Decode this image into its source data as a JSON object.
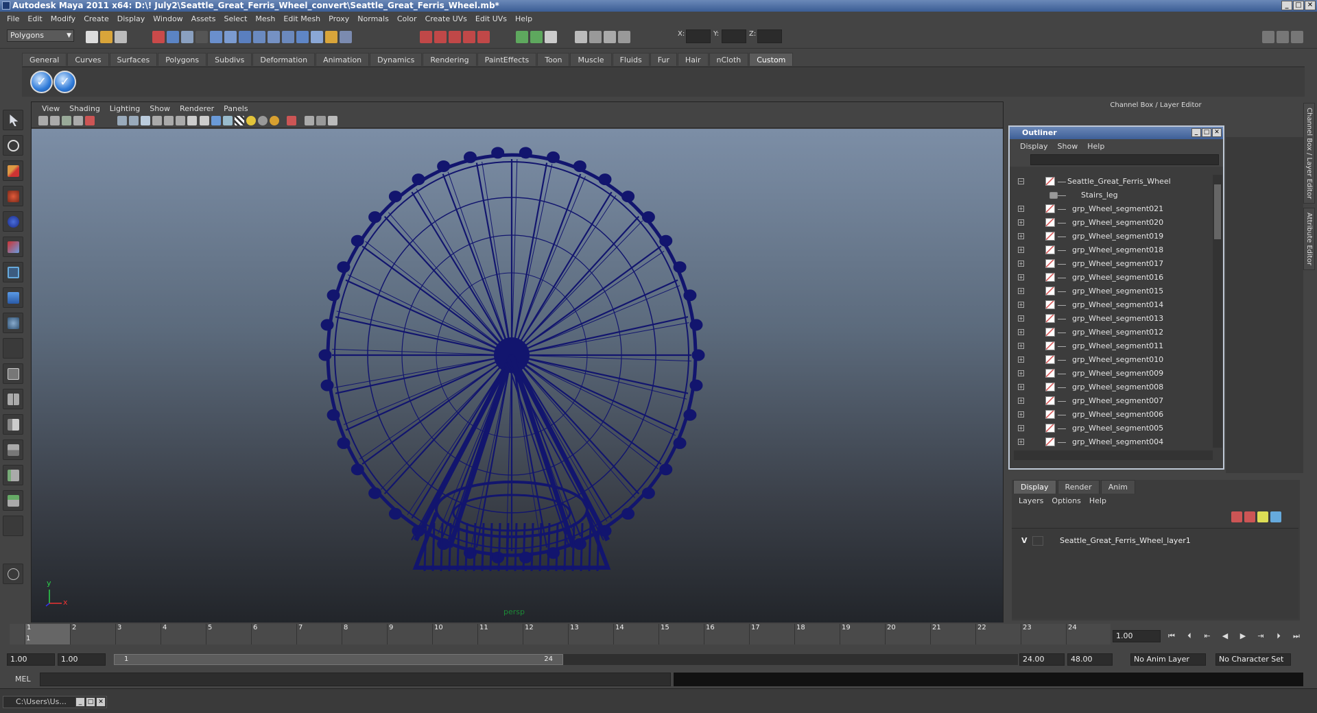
{
  "window": {
    "title": "Autodesk Maya 2011 x64: D:\\! July2\\Seattle_Great_Ferris_Wheel_convert\\Seattle_Great_Ferris_Wheel.mb*",
    "controls": [
      "_",
      "□",
      "✕"
    ]
  },
  "menubar": [
    "File",
    "Edit",
    "Modify",
    "Create",
    "Display",
    "Window",
    "Assets",
    "Select",
    "Mesh",
    "Edit Mesh",
    "Proxy",
    "Normals",
    "Color",
    "Create UVs",
    "Edit UVs",
    "Help"
  ],
  "statusline": {
    "mode": "Polygons",
    "x_label": "X:",
    "y_label": "Y:",
    "z_label": "Z:"
  },
  "shelf": {
    "tabs": [
      "General",
      "Curves",
      "Surfaces",
      "Polygons",
      "Subdivs",
      "Deformation",
      "Animation",
      "Dynamics",
      "Rendering",
      "PaintEffects",
      "Toon",
      "Muscle",
      "Fluids",
      "Fur",
      "Hair",
      "nCloth",
      "Custom"
    ],
    "active_tab": "Custom",
    "buttons": [
      "check-icon",
      "check-icon"
    ]
  },
  "viewport": {
    "menu": [
      "View",
      "Shading",
      "Lighting",
      "Show",
      "Renderer",
      "Panels"
    ],
    "camera_label": "persp",
    "axis_y": "y",
    "axis_x": "x",
    "wire_color": "#12156e"
  },
  "channelbox": {
    "title": "Channel Box / Layer Editor"
  },
  "outliner": {
    "title": "Outliner",
    "menu": [
      "Display",
      "Show",
      "Help"
    ],
    "items": [
      {
        "label": "Seattle_Great_Ferris_Wheel",
        "kind": "root",
        "expander": "−"
      },
      {
        "label": "Stairs_leg",
        "kind": "child",
        "expander": ""
      },
      {
        "label": "grp_Wheel_segment021",
        "kind": "group",
        "expander": "+"
      },
      {
        "label": "grp_Wheel_segment020",
        "kind": "group",
        "expander": "+"
      },
      {
        "label": "grp_Wheel_segment019",
        "kind": "group",
        "expander": "+"
      },
      {
        "label": "grp_Wheel_segment018",
        "kind": "group",
        "expander": "+"
      },
      {
        "label": "grp_Wheel_segment017",
        "kind": "group",
        "expander": "+"
      },
      {
        "label": "grp_Wheel_segment016",
        "kind": "group",
        "expander": "+"
      },
      {
        "label": "grp_Wheel_segment015",
        "kind": "group",
        "expander": "+"
      },
      {
        "label": "grp_Wheel_segment014",
        "kind": "group",
        "expander": "+"
      },
      {
        "label": "grp_Wheel_segment013",
        "kind": "group",
        "expander": "+"
      },
      {
        "label": "grp_Wheel_segment012",
        "kind": "group",
        "expander": "+"
      },
      {
        "label": "grp_Wheel_segment011",
        "kind": "group",
        "expander": "+"
      },
      {
        "label": "grp_Wheel_segment010",
        "kind": "group",
        "expander": "+"
      },
      {
        "label": "grp_Wheel_segment009",
        "kind": "group",
        "expander": "+"
      },
      {
        "label": "grp_Wheel_segment008",
        "kind": "group",
        "expander": "+"
      },
      {
        "label": "grp_Wheel_segment007",
        "kind": "group",
        "expander": "+"
      },
      {
        "label": "grp_Wheel_segment006",
        "kind": "group",
        "expander": "+"
      },
      {
        "label": "grp_Wheel_segment005",
        "kind": "group",
        "expander": "+"
      },
      {
        "label": "grp_Wheel_segment004",
        "kind": "group",
        "expander": "+"
      }
    ]
  },
  "layer_editor": {
    "tabs": [
      "Display",
      "Render",
      "Anim"
    ],
    "active_tab": "Display",
    "menu": [
      "Layers",
      "Options",
      "Help"
    ],
    "layers": [
      {
        "visible": "V",
        "name": "Seattle_Great_Ferris_Wheel_layer1"
      }
    ]
  },
  "side_tabs": [
    "Channel Box / Layer Editor",
    "Attribute Editor"
  ],
  "timeslider": {
    "ticks": [
      "1",
      "2",
      "3",
      "4",
      "5",
      "6",
      "7",
      "8",
      "9",
      "10",
      "11",
      "12",
      "13",
      "14",
      "15",
      "16",
      "17",
      "18",
      "19",
      "20",
      "21",
      "22",
      "23",
      "24"
    ],
    "current_frame": "1",
    "current_time": "1.00"
  },
  "rangeslider": {
    "start_time": "1.00",
    "playback_start": "1.00",
    "range_start": "1",
    "range_end": "24",
    "playback_end": "24.00",
    "end_time": "48.00",
    "anim_layer": "No Anim Layer",
    "character_set": "No Character Set"
  },
  "commandline": {
    "label": "MEL"
  },
  "taskbar": {
    "item": "C:\\Users\\Us..."
  }
}
